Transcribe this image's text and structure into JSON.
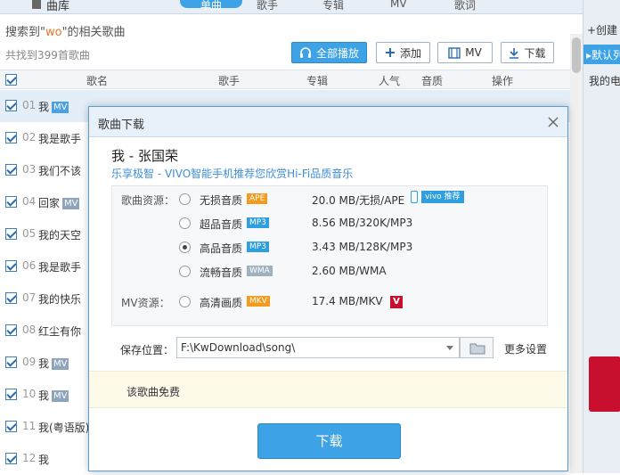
{
  "topbar": {
    "library_label": "曲库",
    "tabs": [
      {
        "label": "单曲",
        "active": true
      },
      {
        "label": "歌手",
        "active": false
      },
      {
        "label": "专辑",
        "active": false
      },
      {
        "label": "MV",
        "active": false
      },
      {
        "label": "歌词",
        "active": false
      }
    ]
  },
  "search": {
    "prefix": "搜索到\"",
    "keyword": "wo",
    "suffix": "\"的相关歌曲",
    "count_text": "共找到399首歌曲"
  },
  "actions": {
    "play_all": "全部播放",
    "add": "添加",
    "mv": "MV",
    "download": "下载"
  },
  "list_header": {
    "song": "歌名",
    "singer": "歌手",
    "album": "专辑",
    "popularity": "人气",
    "quality": "音质",
    "operation": "操作"
  },
  "songs": [
    {
      "num": "01",
      "title": "我",
      "mv": "MV",
      "selected": true
    },
    {
      "num": "02",
      "title": "我是歌手",
      "mv": "",
      "selected": false
    },
    {
      "num": "03",
      "title": "我们不该",
      "mv": "",
      "selected": false
    },
    {
      "num": "04",
      "title": "回家",
      "mv": "MV",
      "selected": false
    },
    {
      "num": "05",
      "title": "我的天空",
      "mv": "",
      "selected": false
    },
    {
      "num": "06",
      "title": "我是歌手",
      "mv": "",
      "selected": false
    },
    {
      "num": "07",
      "title": "我的快乐",
      "mv": "",
      "selected": false
    },
    {
      "num": "08",
      "title": "红尘有你",
      "mv": "",
      "selected": false
    },
    {
      "num": "09",
      "title": "我",
      "mv": "MV",
      "selected": false
    },
    {
      "num": "10",
      "title": "我",
      "mv": "MV",
      "selected": false
    },
    {
      "num": "11",
      "title": "我(粤语版)",
      "mv": "",
      "selected": false
    },
    {
      "num": "12",
      "title": "我",
      "mv": "",
      "selected": false
    }
  ],
  "right_panel": {
    "create": "+创建",
    "default_list": "▸默认列",
    "mine": "我的电"
  },
  "dialog": {
    "title": "歌曲下载",
    "song_name": "我 - 张国荣",
    "promo": "乐享极智 - VIVO智能手机推荐您欣赏Hi-Fi品质音乐",
    "source_label": "歌曲资源：",
    "mv_label": "MV资源：",
    "qualities": [
      {
        "name": "无损音质",
        "tag": "APE",
        "info": "20.0 MB/无损/APE",
        "checked": false
      },
      {
        "name": "超品音质",
        "tag": "MP3",
        "info": "8.56 MB/320K/MP3",
        "checked": false
      },
      {
        "name": "高品音质",
        "tag": "MP3",
        "info": "3.43 MB/128K/MP3",
        "checked": true
      },
      {
        "name": "流畅音质",
        "tag": "WMA",
        "info": "2.60 MB/WMA",
        "checked": false
      }
    ],
    "mv_quality": {
      "name": "高清画质",
      "tag": "MKV",
      "info": "17.4 MB/MKV",
      "checked": false
    },
    "vivo_badge": "vivo 推荐",
    "v_badge": "V",
    "save_label": "保存位置：",
    "save_path": "F:\\KwDownload\\song\\",
    "more_settings": "更多设置",
    "free_text": "该歌曲免费",
    "download_button": "下载"
  }
}
